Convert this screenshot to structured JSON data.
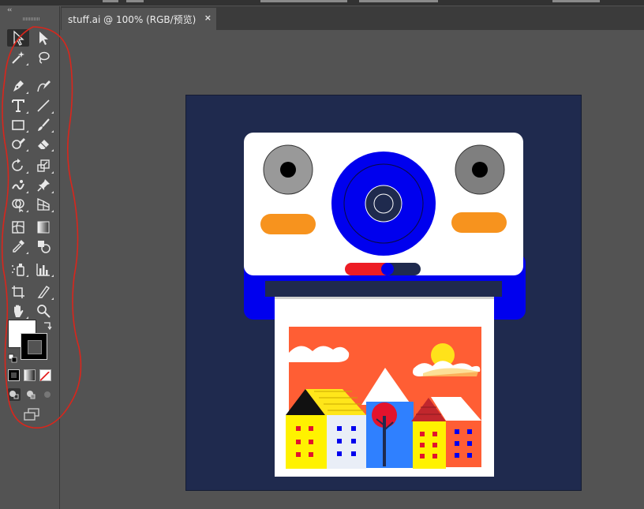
{
  "window": {
    "tab_title": "stuff.ai @ 100% (RGB/预览)",
    "tab_close": "×",
    "collapse_arrows": "‹‹"
  },
  "colors": {
    "workspace": "#535353",
    "artboard": "#1f2a4e",
    "camera_blue": "#0000ee",
    "highlight": "#d9261c",
    "photo_sky": "#ff5e34"
  },
  "tools": [
    {
      "name": "selection-tool",
      "icon": "arrow-outline-icon"
    },
    {
      "name": "direct-selection-tool",
      "icon": "arrow-filled-icon"
    },
    {
      "name": "magic-wand-tool",
      "icon": "magic-wand-icon"
    },
    {
      "name": "lasso-tool",
      "icon": "lasso-icon"
    },
    {
      "name": "pen-tool",
      "icon": "pen-icon"
    },
    {
      "name": "curvature-tool",
      "icon": "curvature-icon"
    },
    {
      "name": "type-tool",
      "icon": "type-icon"
    },
    {
      "name": "line-segment-tool",
      "icon": "line-icon"
    },
    {
      "name": "rectangle-tool",
      "icon": "rectangle-icon"
    },
    {
      "name": "paintbrush-tool",
      "icon": "brush-icon"
    },
    {
      "name": "shaper-tool",
      "icon": "shaper-icon"
    },
    {
      "name": "eraser-tool",
      "icon": "eraser-icon"
    },
    {
      "name": "rotate-tool",
      "icon": "rotate-icon"
    },
    {
      "name": "scale-tool",
      "icon": "scale-icon"
    },
    {
      "name": "warp-tool",
      "icon": "warp-icon"
    },
    {
      "name": "puppet-warp-tool",
      "icon": "pin-icon"
    },
    {
      "name": "shape-builder-tool",
      "icon": "shape-builder-icon"
    },
    {
      "name": "perspective-grid-tool",
      "icon": "perspective-icon"
    },
    {
      "name": "mesh-tool",
      "icon": "mesh-icon"
    },
    {
      "name": "gradient-tool",
      "icon": "gradient-icon"
    },
    {
      "name": "eyedropper-tool",
      "icon": "eyedropper-icon"
    },
    {
      "name": "blend-tool",
      "icon": "blend-icon"
    },
    {
      "name": "symbol-sprayer-tool",
      "icon": "symbol-sprayer-icon"
    },
    {
      "name": "column-graph-tool",
      "icon": "bar-graph-icon"
    },
    {
      "name": "artboard-tool",
      "icon": "artboard-icon"
    },
    {
      "name": "slice-tool",
      "icon": "knife-icon"
    },
    {
      "name": "hand-tool",
      "icon": "hand-icon"
    },
    {
      "name": "zoom-tool",
      "icon": "magnifier-icon"
    }
  ],
  "fill_stroke": {
    "fill_color": "#ffffff",
    "stroke_color": "#000000",
    "swap_icon": "swap-arrows-icon",
    "default_icon": "default-colors-icon"
  },
  "color_modes": [
    "color-mode-icon",
    "gradient-mode-icon",
    "none-mode-icon"
  ],
  "draw_modes": [
    "draw-normal-icon",
    "draw-behind-icon",
    "draw-inside-icon"
  ],
  "screen_mode_icon": "screen-mode-icon"
}
